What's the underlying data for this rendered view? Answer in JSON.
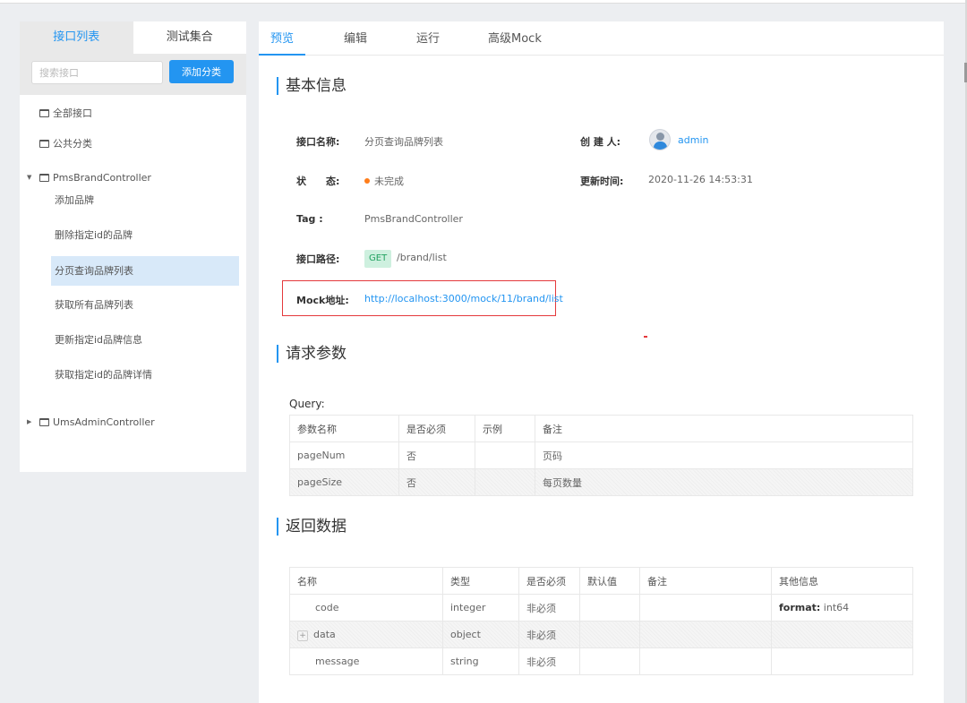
{
  "sidebar": {
    "tabs": [
      "接口列表",
      "测试集合"
    ],
    "search_placeholder": "搜索接口",
    "add_category_label": "添加分类",
    "all_interfaces": "全部接口",
    "public_category": "公共分类",
    "brand_controller": "PmsBrandController",
    "brand_items": [
      "添加品牌",
      "删除指定id的品牌",
      "分页查询品牌列表",
      "获取所有品牌列表",
      "更新指定id品牌信息",
      "获取指定id的品牌详情"
    ],
    "admin_controller": "UmsAdminController"
  },
  "tabs": [
    "预览",
    "编辑",
    "运行",
    "高级Mock"
  ],
  "basic": {
    "title": "基本信息",
    "name_label": "接口名称:",
    "name_value": "分页查询品牌列表",
    "creator_label": "创 建 人:",
    "creator_value": "admin",
    "status_label": "状　　态:",
    "status_value": "未完成",
    "updated_label": "更新时间:",
    "updated_value": "2020-11-26 14:53:31",
    "tag_label": "Tag :",
    "tag_value": "PmsBrandController",
    "path_label": "接口路径:",
    "method": "GET",
    "path_value": "/brand/list",
    "mock_label": "Mock地址:",
    "mock_value": "http://localhost:3000/mock/11/brand/list"
  },
  "request": {
    "title": "请求参数",
    "query_label": "Query:",
    "headers": [
      "参数名称",
      "是否必须",
      "示例",
      "备注"
    ],
    "rows": [
      [
        "pageNum",
        "否",
        "",
        "页码"
      ],
      [
        "pageSize",
        "否",
        "",
        "每页数量"
      ]
    ]
  },
  "response": {
    "title": "返回数据",
    "headers": [
      "名称",
      "类型",
      "是否必须",
      "默认值",
      "备注",
      "其他信息"
    ],
    "rows": [
      {
        "name": "code",
        "type": "integer",
        "required": "非必须",
        "default": "",
        "note": "",
        "other_key": "format:",
        "other_val": " int64"
      },
      {
        "name": "data",
        "type": "object",
        "required": "非必须",
        "default": "",
        "note": "",
        "other_key": "",
        "other_val": ""
      },
      {
        "name": "message",
        "type": "string",
        "required": "非必须",
        "default": "",
        "note": "",
        "other_key": "",
        "other_val": ""
      }
    ]
  },
  "colors": {
    "accent": "#2395f1",
    "status_orange": "#ff7d1a",
    "mock_border": "#e4393c",
    "get_bg": "#cef0df"
  }
}
